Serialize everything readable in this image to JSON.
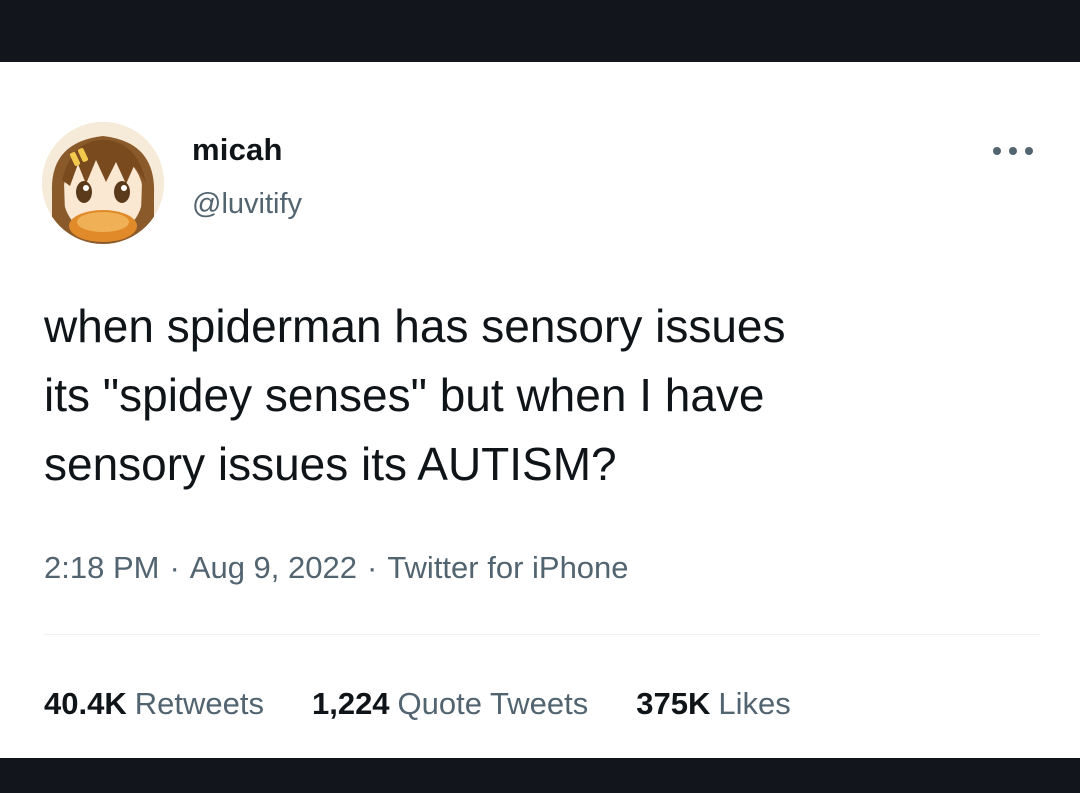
{
  "tweet": {
    "author": {
      "display_name": "micah",
      "handle": "@luvitify",
      "avatar_icon": "anime-character-avatar"
    },
    "more_icon": "more-options-icon",
    "text_lines": [
      "when spiderman has sensory issues",
      "its \"spidey senses\" but when I have",
      "sensory issues its AUTISM?"
    ],
    "meta": {
      "time": "2:18 PM",
      "date": "Aug 9, 2022",
      "source": "Twitter for iPhone",
      "separator": "·"
    },
    "stats": {
      "retweets": {
        "count": "40.4K",
        "label": "Retweets"
      },
      "quote_tweets": {
        "count": "1,224",
        "label": "Quote Tweets"
      },
      "likes": {
        "count": "375K",
        "label": "Likes"
      }
    }
  },
  "colors": {
    "frame": "#12151b",
    "card": "#ffffff",
    "primary_text": "#0f1419",
    "secondary_text": "#536471",
    "divider": "#eff3f4"
  }
}
